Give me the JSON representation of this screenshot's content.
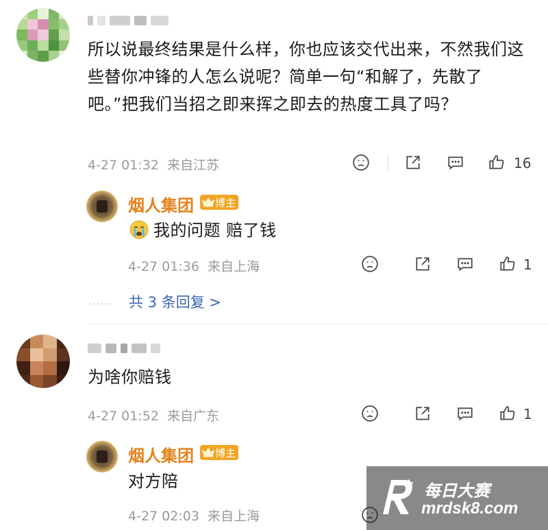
{
  "comments": [
    {
      "text": "所以说最终结果是什么样，你也应该交代出来，不然我们这些替你冲锋的人怎么说呢？简单一句“和解了，先散了吧。”把我们当招之即来挥之即去的热度工具了吗？",
      "time": "4-27 01:32",
      "location": "来自江苏",
      "likes": "16",
      "reply": {
        "author": "烟人集团",
        "badge": "博主",
        "text": "我的问题 赔了钱",
        "time": "4-27 01:36",
        "location": "来自上海",
        "likes": "1"
      },
      "more_replies": "共 3 条回复 >"
    },
    {
      "text": "为啥你赔钱",
      "time": "4-27 01:52",
      "location": "来自广东",
      "likes": "1",
      "reply": {
        "author": "烟人集团",
        "badge": "博主",
        "text": "对方陪",
        "time": "4-27 02:03",
        "location": "来自上海"
      }
    }
  ],
  "watermark": {
    "brand": "每日大赛",
    "site": "mrdsk8.com"
  },
  "colors": {
    "author": "#e3831c",
    "badge": "#f2a523",
    "link": "#3a66b0",
    "meta": "#9a9a9a"
  },
  "icons": [
    "dislike-icon",
    "share-icon",
    "comment-icon",
    "like-icon",
    "crying-emoji-icon",
    "crown-icon"
  ]
}
